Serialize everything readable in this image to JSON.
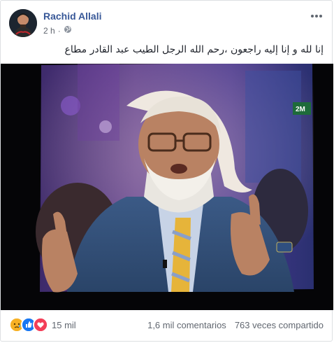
{
  "post": {
    "author": "Rachid Allali",
    "time": "2 h",
    "privacy_icon": "globe-icon",
    "text": "إنا لله و إنا إليه راجعون ،رحم الله الرجل الطيب عبد القادر مطاع"
  },
  "photo": {
    "channel_logo": "2M"
  },
  "footer": {
    "reactions": [
      "sad-react-icon",
      "like-react-icon",
      "love-react-icon"
    ],
    "reaction_count": "15 mil",
    "comments": "1,6 mil comentarios",
    "shares": "763 veces compartido"
  },
  "colors": {
    "link_blue": "#385898",
    "like_blue": "#1877f2",
    "love_red": "#f33e58",
    "sad_yellow": "#f7b125"
  }
}
